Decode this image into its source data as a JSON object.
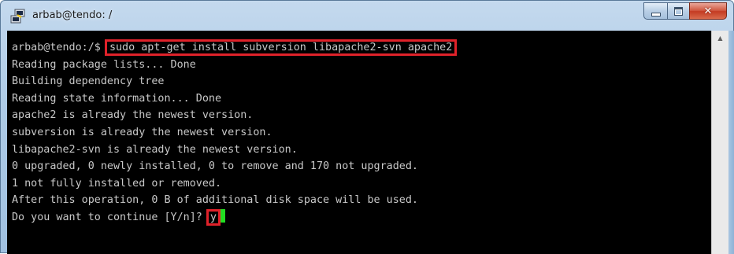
{
  "window": {
    "title": "arbab@tendo: /",
    "app_icon": "putty-icon",
    "controls": {
      "minimize_icon": "minimize-icon",
      "maximize_icon": "maximize-icon",
      "close_icon": "close-icon",
      "close_glyph": "✕"
    }
  },
  "terminal": {
    "prompt": "arbab@tendo:/$ ",
    "command": "sudo apt-get install subversion libapache2-svn apache2",
    "output": [
      "Reading package lists... Done",
      "Building dependency tree",
      "Reading state information... Done",
      "apache2 is already the newest version.",
      "subversion is already the newest version.",
      "libapache2-svn is already the newest version.",
      "0 upgraded, 0 newly installed, 0 to remove and 170 not upgraded.",
      "1 not fully installed or removed.",
      "After this operation, 0 B of additional disk space will be used."
    ],
    "question": "Do you want to continue [Y/n]? ",
    "answer": "y",
    "colors": {
      "background": "#000000",
      "foreground": "#c8c8c8",
      "cursor": "#22dd22",
      "highlight": "#e0222a"
    }
  },
  "scrollbar": {
    "up_arrow": "▲"
  }
}
